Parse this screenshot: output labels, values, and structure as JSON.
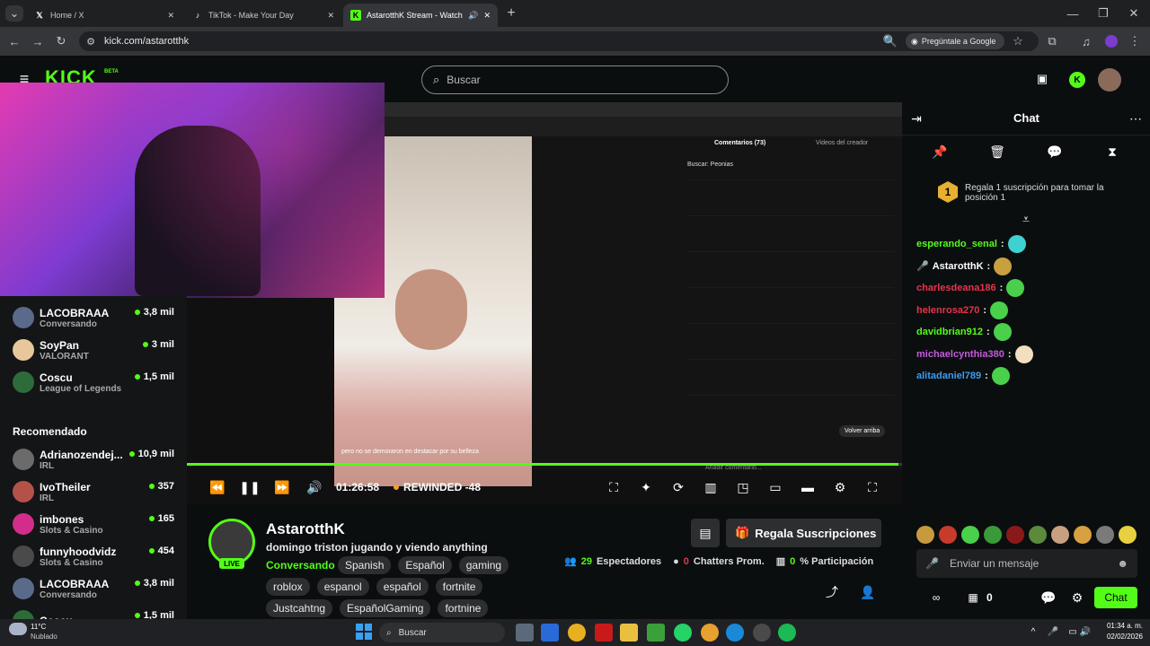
{
  "browser": {
    "tabs": [
      {
        "title": "Home / X",
        "icon": "x-logo-icon"
      },
      {
        "title": "TikTok - Make Your Day",
        "icon": "tiktok-icon"
      },
      {
        "title": "AstarotthK Stream - Watch Li",
        "icon": "kick-icon"
      }
    ],
    "url": "kick.com/astarotthk",
    "ask_google": "Pregúntale a Google"
  },
  "header": {
    "logo": "KICK",
    "logo_badge": "BETA",
    "search_placeholder": "Buscar"
  },
  "sidebar": {
    "top_items": [
      {
        "name": "LACOBRAAA",
        "category": "Conversando",
        "viewers": "3,8 mil",
        "color": "#5a6a8a"
      },
      {
        "name": "SoyPan",
        "category": "VALORANT",
        "viewers": "3 mil",
        "color": "#e8c89a"
      },
      {
        "name": "Coscu",
        "category": "League of Legends",
        "viewers": "1,5 mil",
        "color": "#2e6b3a"
      }
    ],
    "recommended_label": "Recomendado",
    "recommended": [
      {
        "name": "Adrianozendej...",
        "category": "IRL",
        "viewers": "10,9 mil",
        "color": "#6b6b6b"
      },
      {
        "name": "IvoTheiler",
        "category": "IRL",
        "viewers": "357",
        "color": "#b4524a"
      },
      {
        "name": "imbones",
        "category": "Slots & Casino",
        "viewers": "165",
        "color": "#d22d8a"
      },
      {
        "name": "funnyhoodvidz",
        "category": "Slots & Casino",
        "viewers": "454",
        "color": "#4a4a4a"
      },
      {
        "name": "LACOBRAAA",
        "category": "Conversando",
        "viewers": "3,8 mil",
        "color": "#5a6a8a"
      },
      {
        "name": "Coscu",
        "category": "",
        "viewers": "1,5 mil",
        "color": "#2e6b3a"
      }
    ]
  },
  "inner_video": {
    "comments_tab": "Comentarios (73)",
    "creator_videos_tab": "Videos del creador",
    "search_label": "Buscar: Peonias",
    "caption": "pero no se demoraron en destacar por su belleza",
    "back_to_top": "Volver arriba",
    "add_comment": "Añadir comentario..."
  },
  "player": {
    "time": "01:26:58",
    "rewind": "REWINDED -48",
    "progress": 0.995
  },
  "stream": {
    "channel": "AstarotthK",
    "title": "domingo triston jugando y viendo anything",
    "live": "LIVE",
    "category": "Conversando",
    "tags_row1": [
      "Spanish",
      "Español",
      "gaming"
    ],
    "tags_row2": [
      "roblox",
      "espanol",
      "español",
      "fortnite"
    ],
    "tags_row3": [
      "Justcahtng",
      "EspañolGaming",
      "fortnine"
    ],
    "gift_button": "Regala Suscripciones",
    "viewers_count": "29",
    "viewers_label": "Espectadores",
    "chatters_count": "0",
    "chatters_label": "Chatters Prom.",
    "participation_count": "0",
    "participation_label": "% Participación"
  },
  "chat": {
    "title": "Chat",
    "gift_prompt": "Regala 1 suscripción para tomar la posición 1",
    "gift_rank": "1",
    "messages": [
      {
        "user": "esperando_senal",
        "color": "#53fc18"
      },
      {
        "user": "AstarotthK",
        "color": "#ffffff"
      },
      {
        "user": "charlesdeana186",
        "color": "#e8334a"
      },
      {
        "user": "helenrosa270",
        "color": "#e8334a"
      },
      {
        "user": "davidbrian912",
        "color": "#53fc18"
      },
      {
        "user": "michaelcynthia380",
        "color": "#c25bd8"
      },
      {
        "user": "alitadaniel789",
        "color": "#3b9cf0"
      }
    ],
    "input_placeholder": "Enviar un mensaje",
    "points": "0",
    "send_button": "Chat"
  },
  "taskbar": {
    "weather_temp": "11°C",
    "weather_desc": "Nublado",
    "search": "Buscar",
    "time": "01:34 a. m.",
    "date": "02/02/2026"
  },
  "colors": {
    "accent": "#53fc18"
  }
}
